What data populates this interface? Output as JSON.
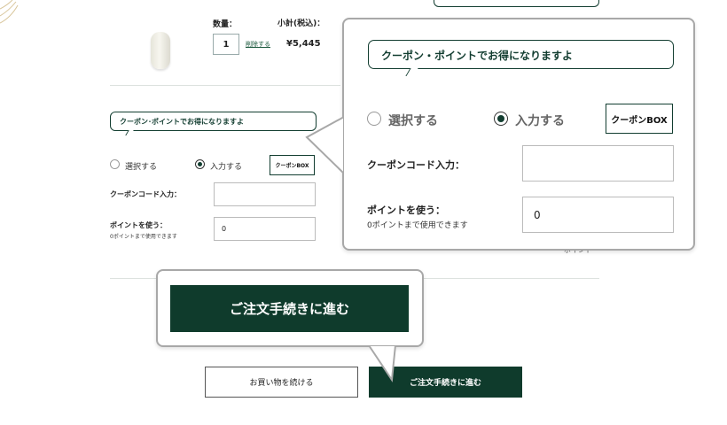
{
  "cart": {
    "quantity_label": "数量：",
    "subtotal_label": "小計(税込)：",
    "quantity_value": "1",
    "delete_label": "削除する",
    "price": "¥5,445"
  },
  "coupon": {
    "bubble_text": "クーポン･ポイントでお得になりますよ",
    "radio_select_label": "選択する",
    "radio_input_label": "入力する",
    "selected_option": "入力する",
    "coupon_box_label": "クーポンBOX",
    "coupon_code_label": "クーポンコード入力：",
    "coupon_code_value": "",
    "point_label": "ポイントを使う：",
    "point_sub_label": "0ポイントまで使用できます",
    "point_value": "0"
  },
  "zoom": {
    "bubble_text": "クーポン・ポイントでお得になりますよ"
  },
  "actions": {
    "continue_label": "お買い物を続ける",
    "checkout_label": "ご注文手続きに進む"
  },
  "colors": {
    "brand_green": "#0f3b2c",
    "callout_border": "#a8a8a8"
  }
}
